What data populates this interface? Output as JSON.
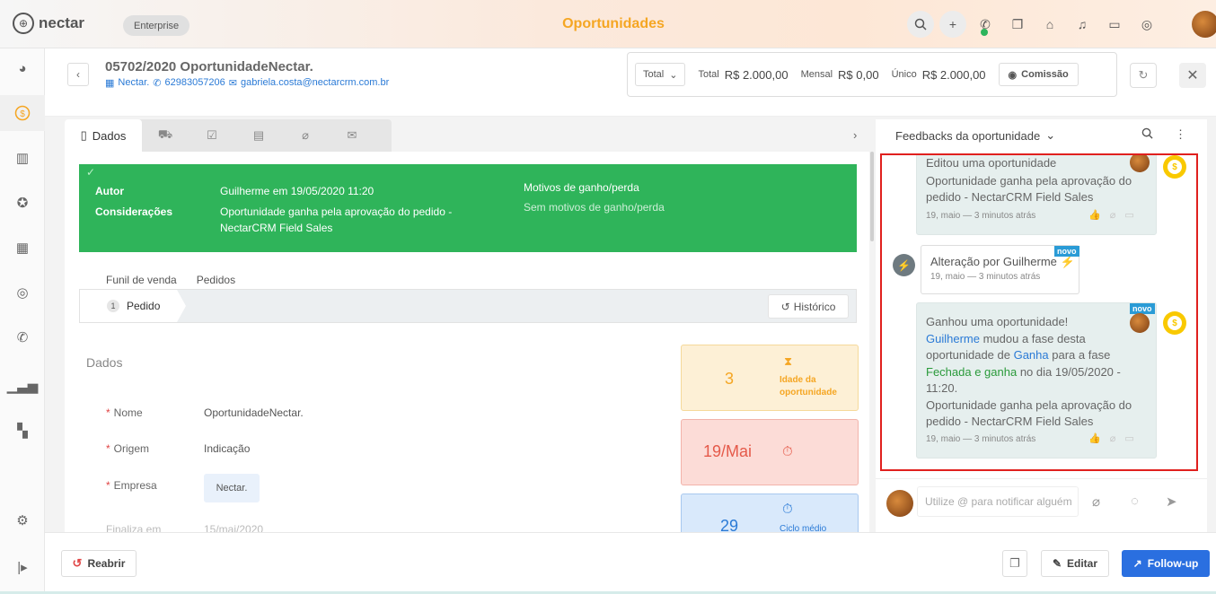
{
  "topbar": {
    "logo_mark": "⊕",
    "logo_text": "nectar",
    "plan": "Enterprise",
    "title": "Oportunidades",
    "icons": [
      "search-icon",
      "plus-icon",
      "phone-icon",
      "copy-icon",
      "bell-icon",
      "inbox-icon",
      "check-circle-icon"
    ],
    "accent_color": "#f5a623"
  },
  "sidebar": {
    "items": [
      "dashboard-icon",
      "money-icon",
      "building-icon",
      "star-icon",
      "calendar-icon",
      "check-icon",
      "phone-icon",
      "chart-icon",
      "widgets-icon",
      "settings-icon",
      "expand-icon"
    ]
  },
  "header": {
    "title": "05702/2020 OportunidadeNectar.",
    "company": "Nectar.",
    "phone": "62983057206",
    "email": "gabriela.costa@nectarcrm.com.br",
    "select_value": "Total",
    "total_label": "Total",
    "total_value": "R$ 2.000,00",
    "mensal_label": "Mensal",
    "mensal_value": "R$ 0,00",
    "unico_label": "Único",
    "unico_value": "R$ 2.000,00",
    "comissao_label": "Comissão"
  },
  "tabs": {
    "active_label": "Dados",
    "others": [
      "cart-icon",
      "checkbox-icon",
      "document-icon",
      "attachment-icon",
      "mail-icon"
    ]
  },
  "banner": {
    "autor_label": "Autor",
    "autor_value": "Guilherme em 19/05/2020 11:20",
    "consideracoes_label": "Considerações",
    "consideracoes_value_1": "Oportunidade ganha pela aprovação do pedido -",
    "consideracoes_value_2": "NectarCRM Field Sales",
    "motivos_label": "Motivos de ganho/perda",
    "motivos_value": "Sem motivos de ganho/perda",
    "color": "#2fb45a"
  },
  "funnel": {
    "tab1": "Funil de venda",
    "tab2": "Pedidos",
    "stage_number": "1",
    "stage_label": "Pedido",
    "historico_label": "Histórico"
  },
  "dados": {
    "section_title": "Dados",
    "nome_label": "Nome",
    "nome_value": "OportunidadeNectar.",
    "origem_label": "Origem",
    "origem_value": "Indicação",
    "empresa_label": "Empresa",
    "empresa_value": "Nectar.",
    "finaliza_label": "Finaliza em",
    "finaliza_value": "15/mai/2020"
  },
  "kpis": {
    "idade_value": "3",
    "idade_label_1": "Idade da",
    "idade_label_2": "oportunidade",
    "data_value": "19/Mai",
    "ciclo_value": "29",
    "ciclo_label": "Ciclo médio"
  },
  "feedback": {
    "header": "Feedbacks da oportunidade",
    "card1": {
      "line1": "Editou uma oportunidade",
      "line2": "Oportunidade ganha pela aprovação do",
      "line3": "pedido - NectarCRM Field Sales",
      "meta": "19, maio — 3 minutos atrás"
    },
    "alt": {
      "text": "Alteração por Guilherme",
      "meta": "19, maio — 3 minutos atrás",
      "badge": "novo"
    },
    "card2": {
      "badge": "novo",
      "line1": "Ganhou uma oportunidade!",
      "user": "Guilherme",
      "t1": " mudou a fase desta",
      "t2": "oportunidade de ",
      "from_stage": "Ganha",
      "t3": " para a fase",
      "to_stage": "Fechada e ganha",
      "t4": " no dia 19/05/2020 -",
      "t5": "11:20.",
      "line_a": "Oportunidade ganha pela aprovação do",
      "line_b": "pedido - NectarCRM Field Sales",
      "meta": "19, maio — 3 minutos atrás"
    },
    "composer_placeholder": "Utilize @ para notificar alguém"
  },
  "bottom": {
    "reabrir": "Reabrir",
    "editar": "Editar",
    "followup": "Follow-up"
  }
}
